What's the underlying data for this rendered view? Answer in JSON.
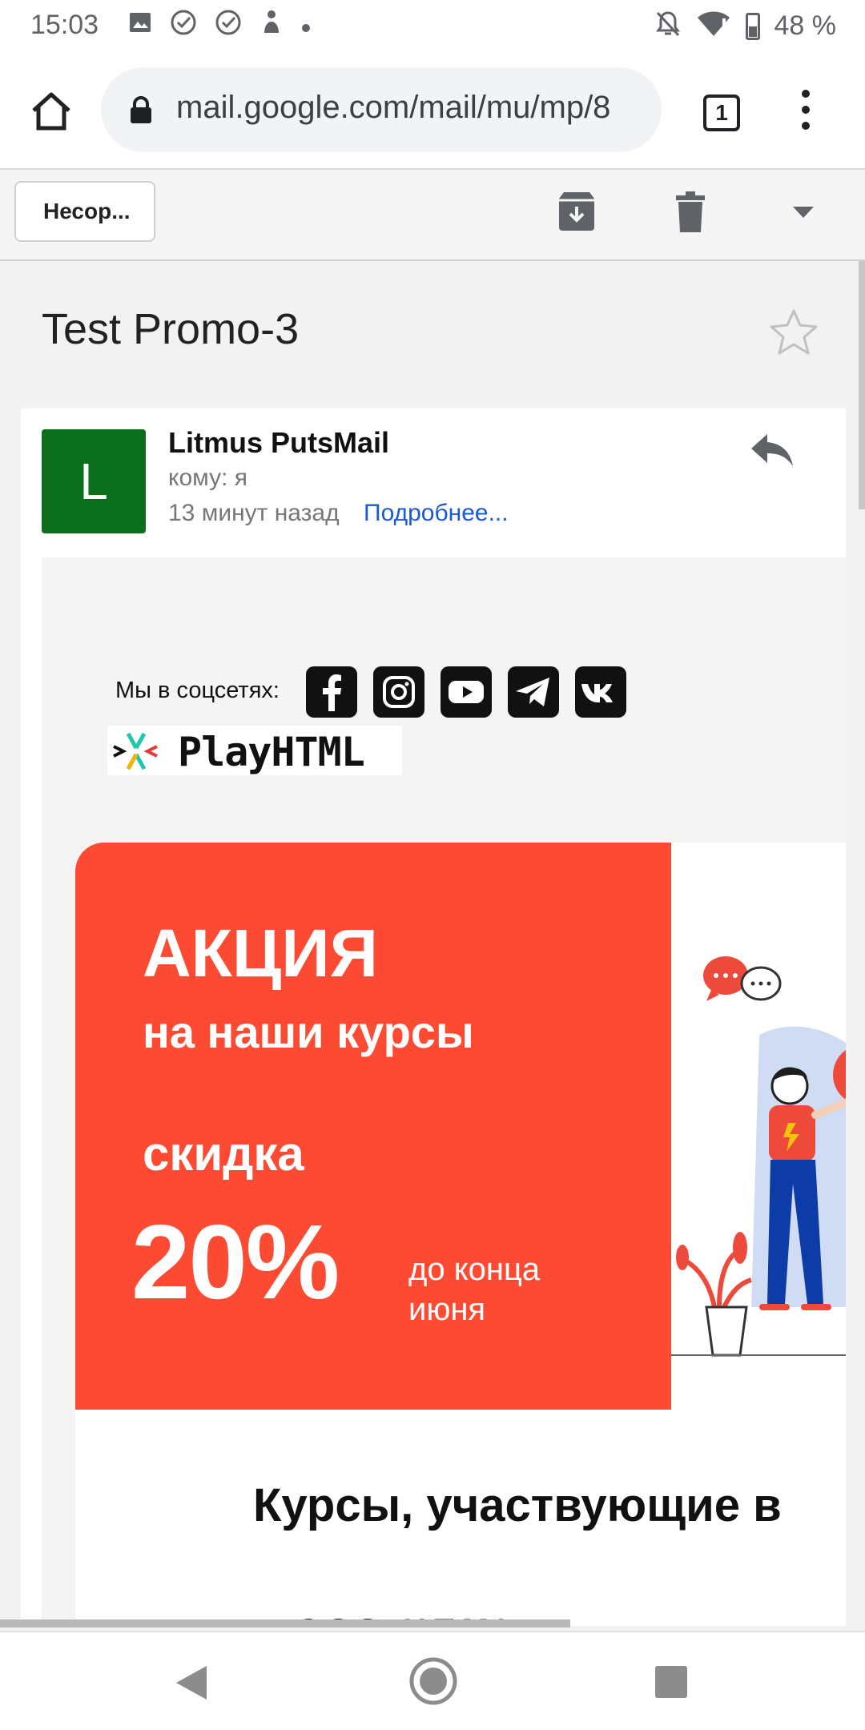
{
  "status_bar": {
    "time": "15:03",
    "icons_left": [
      "image-icon",
      "check-circle-icon",
      "check-circle-icon",
      "figure-icon",
      "dot-icon"
    ],
    "icons_right": [
      "mute-icon",
      "wifi-icon",
      "battery-icon"
    ],
    "battery": "48 %"
  },
  "browser": {
    "url": "mail.google.com/mail/mu/mp/8",
    "tabs_count": "1"
  },
  "toolbar": {
    "back_label": "Несор..."
  },
  "message": {
    "subject": "Test Promo-3",
    "avatar_letter": "L",
    "sender": "Litmus PutsMail",
    "to": "кому: я",
    "time": "13 минут назад",
    "details_link": "Подробнее..."
  },
  "email": {
    "social_label": "Мы в соцсетях:",
    "social_icons": [
      "facebook-icon",
      "instagram-icon",
      "youtube-icon",
      "telegram-icon",
      "vk-icon"
    ],
    "logo_text": "PlayHTML",
    "banner": {
      "title": "АКЦИЯ",
      "subtitle": "на наши курсы",
      "discount_label": "скидка",
      "discount_value": "20%",
      "until": "до конца июня",
      "color": "#fd4a33"
    },
    "courses_heading": "Курсы, участвующие в",
    "cut_text": "CSS HTML"
  },
  "colors": {
    "avatar": "#0b6e1d",
    "link": "#1a58d6"
  }
}
